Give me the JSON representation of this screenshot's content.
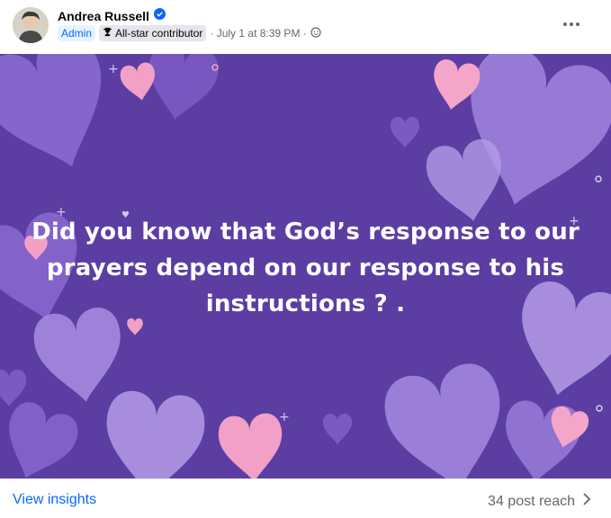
{
  "post": {
    "author": "Andrea Russell",
    "role_badge": "Admin",
    "contributor_badge": "All-star contributor",
    "timestamp": "· July 1 at 8:39 PM ·",
    "verified_icon": "verified-check-icon",
    "audience_icon": "globe-icon",
    "more_icon": "more-dots-icon"
  },
  "image": {
    "background_color": "#5c3ea3",
    "heart_colors": [
      "#8a6ad0",
      "#9d80dc",
      "#b49be6",
      "#f2a0c6"
    ],
    "text": "Did you know that God’s response to our prayers depend on our response to his instructions ? ."
  },
  "footer": {
    "insights_label": "View insights",
    "reach_label": "34 post reach",
    "chevron_icon": "chevron-right-icon"
  }
}
